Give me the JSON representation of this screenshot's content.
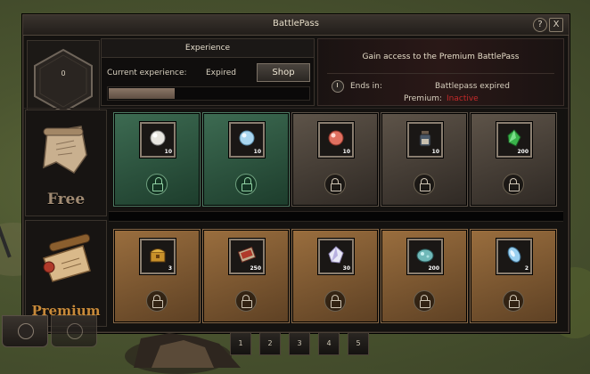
{
  "window": {
    "title": "BattlePass"
  },
  "titlebar": {
    "help_label": "?",
    "close_label": "X"
  },
  "level": {
    "value": "0"
  },
  "experience": {
    "header": "Experience",
    "current_label": "Current experience:",
    "current_value": "Expired",
    "shop_label": "Shop",
    "progress_fraction": 0.33
  },
  "premium_info": {
    "access_text": "Gain access to the Premium BattlePass",
    "ends_label": "Ends in:",
    "ends_value": "Battlepass expired",
    "premium_label": "Premium:",
    "premium_status": "Inactive",
    "status_color": "#c62a2a"
  },
  "tracks": {
    "free": {
      "name": "Free",
      "slots": [
        {
          "icon": "white-pearl-icon",
          "qty": "10",
          "lock": "unlocked"
        },
        {
          "icon": "blue-pearl-icon",
          "qty": "10",
          "lock": "unlocked"
        },
        {
          "icon": "red-pearl-icon",
          "qty": "10",
          "lock": "locked"
        },
        {
          "icon": "potion-flask-icon",
          "qty": "10",
          "lock": "locked"
        },
        {
          "icon": "green-crystal-icon",
          "qty": "200",
          "lock": "locked"
        }
      ]
    },
    "premium": {
      "name": "Premium",
      "slots": [
        {
          "icon": "gold-chest-icon",
          "qty": "3",
          "lock": "locked"
        },
        {
          "icon": "red-scroll-icon",
          "qty": "250",
          "lock": "locked"
        },
        {
          "icon": "white-crystal-icon",
          "qty": "30",
          "lock": "locked"
        },
        {
          "icon": "teal-ore-icon",
          "qty": "200",
          "lock": "locked"
        },
        {
          "icon": "blue-stone-icon",
          "qty": "2",
          "lock": "locked"
        }
      ]
    }
  },
  "pages": [
    "1",
    "2",
    "3",
    "4",
    "5"
  ],
  "colors": {
    "free_unlocked_bg": "#3d6b52",
    "free_locked_bg": "#5e5449",
    "premium_bg": "#9a6e3e",
    "premium_name": "#c88a3a",
    "free_name": "#a08a72"
  }
}
